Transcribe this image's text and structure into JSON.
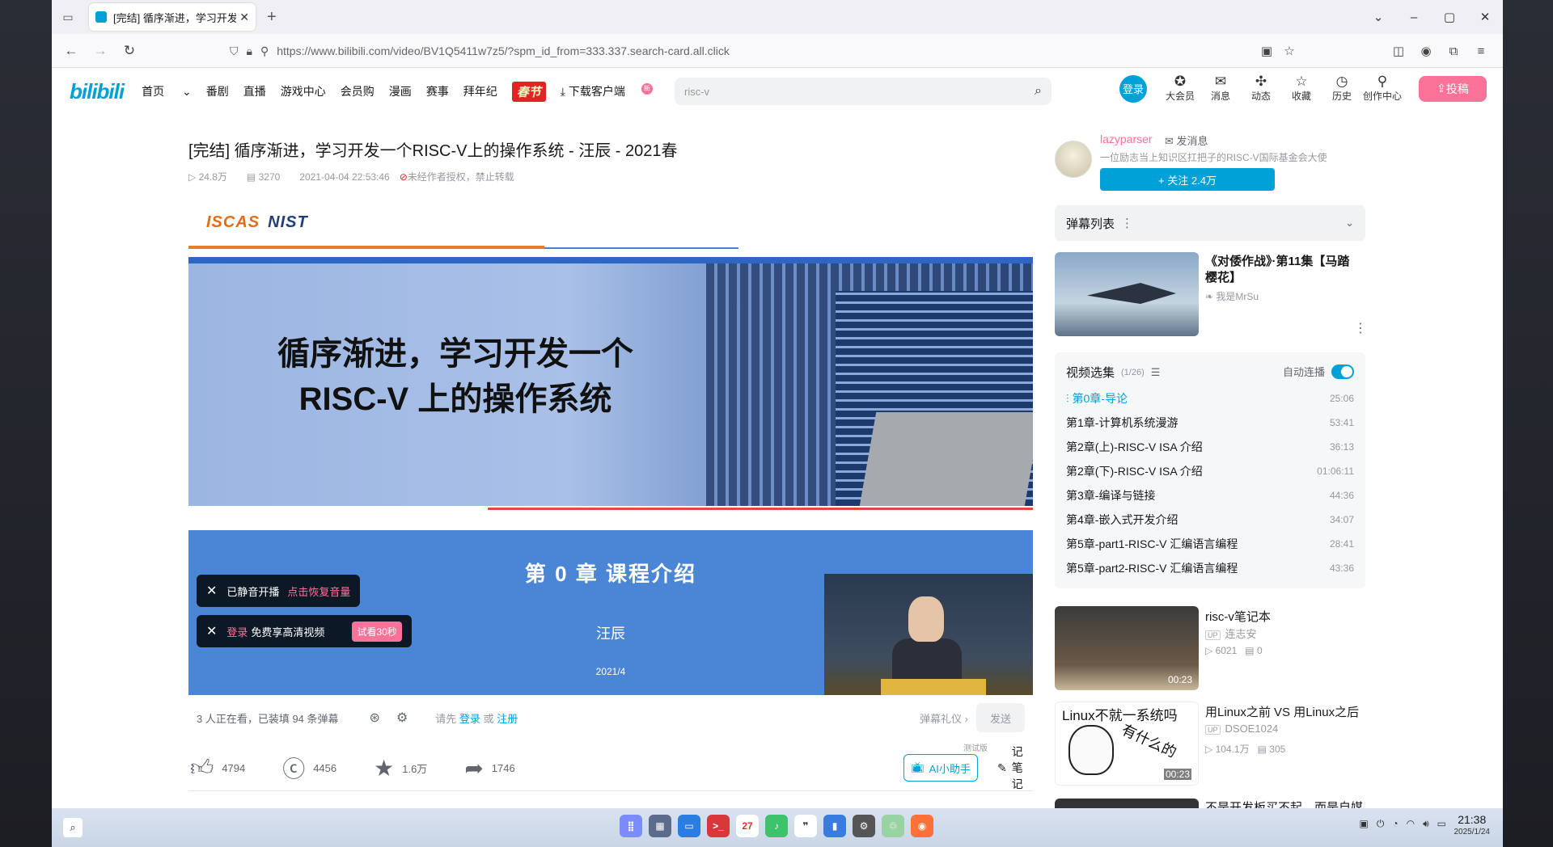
{
  "browser": {
    "tab_title": "[完结] 循序渐进，学习开发",
    "url": "https://www.bilibili.com/video/BV1Q5411w7z5/?spm_id_from=333.337.search-card.all.click"
  },
  "site": {
    "logo": "bilibili",
    "menu": [
      "首页",
      "番剧",
      "直播",
      "游戏中心",
      "会员购",
      "漫画",
      "赛事",
      "拜年纪"
    ],
    "festival_badge": "春节",
    "download_client": "下载客户端",
    "download_badge": "新",
    "search_value": "risc-v",
    "login": "登录",
    "user_icons": [
      {
        "label": "大会员",
        "icon": "vip-icon"
      },
      {
        "label": "消息",
        "icon": "message-icon"
      },
      {
        "label": "动态",
        "icon": "dynamic-icon"
      },
      {
        "label": "收藏",
        "icon": "favorite-icon"
      },
      {
        "label": "历史",
        "icon": "history-icon"
      },
      {
        "label": "创作中心",
        "icon": "creator-icon"
      }
    ],
    "upload": "投稿"
  },
  "video": {
    "title": "[完结] 循序渐进，学习开发一个RISC-V上的操作系统 - 汪辰 - 2021春",
    "views": "24.8万",
    "danmaku_count": "3270",
    "date": "2021-04-04 22:53:46",
    "copyright": "未经作者授权，禁止转载"
  },
  "player": {
    "slide_logo_1": "ISCAS",
    "slide_logo_2": "NIST",
    "hero_line1": "循序渐进，学习开发一个",
    "hero_line2": "RISC-V 上的操作系统",
    "chapter": "第 0 章 课程介绍",
    "speaker": "汪辰",
    "slide_date": "2021/4",
    "toast_muted": "已静音开播",
    "toast_muted_action": "点击恢复音量",
    "toast_login_link": "登录",
    "toast_login_text": "免费享高清视频",
    "toast_try": "试看30秒"
  },
  "danmaku_bar": {
    "viewers": "3 人正在看，已装填 94 条弹幕",
    "prompt_prefix": "请先",
    "login": "登录",
    "or": "或",
    "register": "注册",
    "etiquette": "弹幕礼仪 ›",
    "send": "发送"
  },
  "actions": {
    "like": "4794",
    "coin": "4456",
    "favorite": "1.6万",
    "share": "1746",
    "ai_assistant": "AI小助手",
    "ai_tag": "测试版",
    "note": "记笔记"
  },
  "uploader": {
    "name": "lazyparser",
    "message": "发消息",
    "desc": "一位励志当上知识区扛把子的RISC-V国际基金会大使",
    "follow": "+ 关注 2.4万"
  },
  "danmaku_list": {
    "label": "弹幕列表"
  },
  "ad": {
    "title": "《对倭作战》·第11集【马踏樱花】",
    "source": "我是MrSu"
  },
  "collection": {
    "title": "视频选集",
    "count": "(1/26)",
    "autoplay": "自动连播",
    "episodes": [
      {
        "title": "第0章-导论",
        "dur": "25:06"
      },
      {
        "title": "第1章-计算机系统漫游",
        "dur": "53:41"
      },
      {
        "title": "第2章(上)-RISC-V ISA 介绍",
        "dur": "36:13"
      },
      {
        "title": "第2章(下)-RISC-V ISA 介绍",
        "dur": "01:06:11"
      },
      {
        "title": "第3章-编译与链接",
        "dur": "44:36"
      },
      {
        "title": "第4章-嵌入式开发介绍",
        "dur": "34:07"
      },
      {
        "title": "第5章-part1-RISC-V 汇编语言编程",
        "dur": "28:41"
      },
      {
        "title": "第5章-part2-RISC-V 汇编语言编程",
        "dur": "43:36"
      }
    ]
  },
  "recommend": [
    {
      "title": "risc-v笔记本",
      "up": "连志安",
      "views": "6021",
      "dm": "0",
      "dur": "00:23"
    },
    {
      "title": "用Linux之前 VS 用Linux之后",
      "up": "DSOE1024",
      "views": "104.1万",
      "dm": "305",
      "dur": "00:23",
      "thumb_text_1": "Linux不就一系统吗",
      "thumb_text_2": "有什么的"
    },
    {
      "title": "不是开发板买不起，而是自媒"
    }
  ],
  "taskbar": {
    "time": "21:38",
    "date": "2025/1/24",
    "calendar_day": "27"
  }
}
